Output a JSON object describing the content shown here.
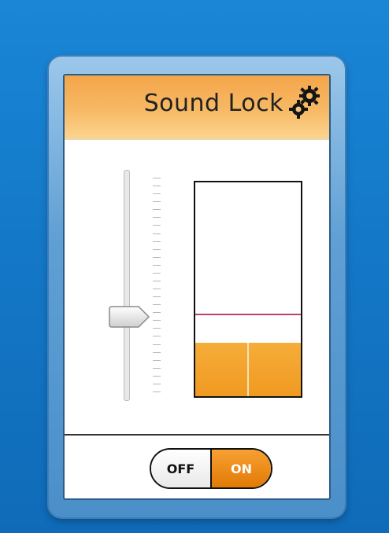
{
  "app": {
    "title": "Sound Lock"
  },
  "icons": {
    "settings": "gears-icon",
    "slider_thumb": "slider-thumb"
  },
  "volume_slider": {
    "level": 0.36
  },
  "meter": {
    "lock_level": 0.38,
    "current_level": 0.25
  },
  "toggle": {
    "off_label": "OFF",
    "on_label": "ON",
    "state": "on"
  },
  "colors": {
    "accent": "#f09a21",
    "lock_line": "#c0406b",
    "header_top": "#f4a54a"
  }
}
